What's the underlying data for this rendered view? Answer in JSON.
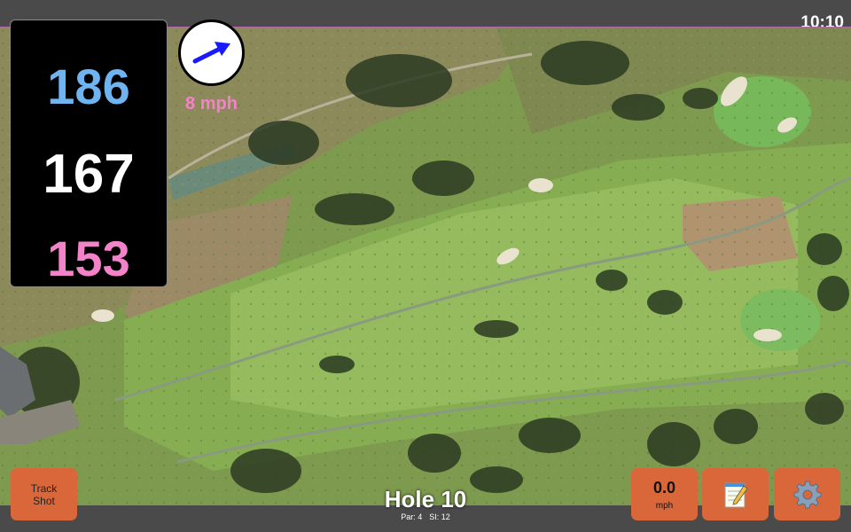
{
  "status": {
    "time": "10:10"
  },
  "distances": {
    "back": "186",
    "middle": "167",
    "front": "153"
  },
  "wind": {
    "speed": "8 mph",
    "direction_icon": "arrow-icon"
  },
  "hole": {
    "title": "Hole 10",
    "par": "Par: 4",
    "si": "SI: 12"
  },
  "buttons": {
    "track_shot_line1": "Track",
    "track_shot_line2": "Shot",
    "speed_value": "0.0",
    "speed_unit": "mph",
    "notes_icon": "notepad-icon",
    "settings_icon": "gear-icon"
  },
  "colors": {
    "back": "#6fb3f0",
    "middle": "#ffffff",
    "front": "#f383c8",
    "button": "#d9673a",
    "wind_arrow": "#1a1aff"
  }
}
